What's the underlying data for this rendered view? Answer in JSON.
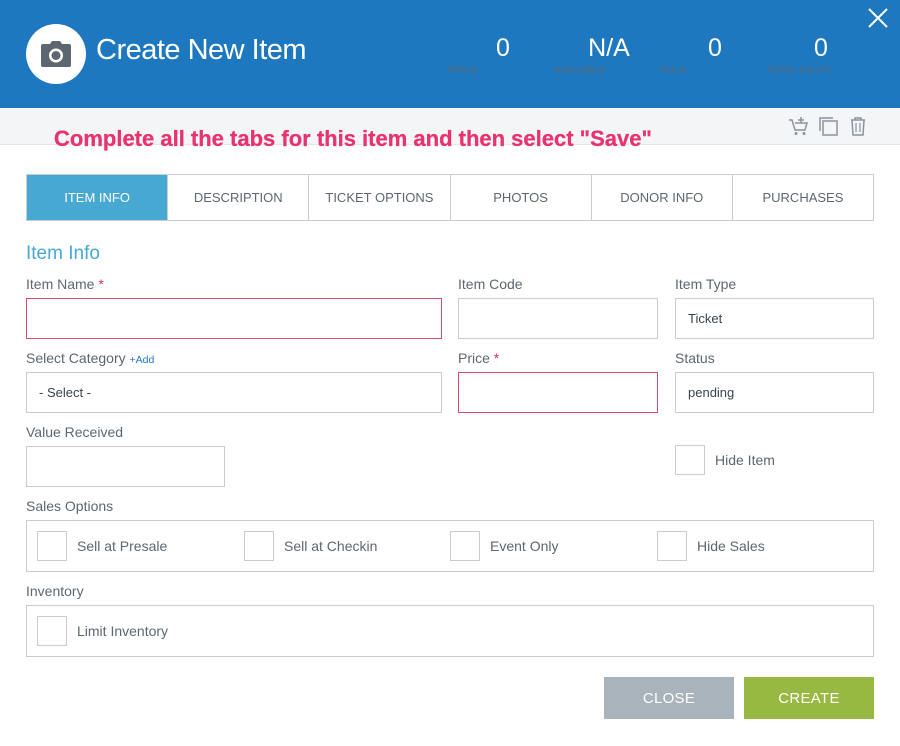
{
  "header": {
    "title": "Create New Item",
    "stats": [
      {
        "value": "0",
        "label": "PRICE"
      },
      {
        "value": "N/A",
        "label": "AVAILABLE"
      },
      {
        "value": "0",
        "label": "SOLD"
      },
      {
        "value": "0",
        "label": "TOTAL SALES"
      }
    ],
    "colors": {
      "bar": "#1e78bf",
      "accent": "#47a9d2"
    }
  },
  "annotation": "Complete all the tabs for this item and then select \"Save\"",
  "toolbar": {
    "icons": [
      "add-to-cart-icon",
      "duplicate-icon",
      "trash-icon"
    ]
  },
  "tabs": [
    {
      "label": "ITEM INFO",
      "active": true
    },
    {
      "label": "DESCRIPTION",
      "active": false
    },
    {
      "label": "TICKET OPTIONS",
      "active": false
    },
    {
      "label": "PHOTOS",
      "active": false
    },
    {
      "label": "DONOR INFO",
      "active": false
    },
    {
      "label": "PURCHASES",
      "active": false
    }
  ],
  "form": {
    "section_title": "Item Info",
    "item_name": {
      "label": "Item Name",
      "required_mark": "*",
      "value": ""
    },
    "item_code": {
      "label": "Item Code",
      "value": ""
    },
    "item_type": {
      "label": "Item Type",
      "value": "Ticket"
    },
    "category": {
      "label": "Select Category",
      "add_link": "+Add",
      "value": "- Select -"
    },
    "price": {
      "label": "Price",
      "required_mark": "*",
      "value": ""
    },
    "status": {
      "label": "Status",
      "value": "pending"
    },
    "value_received": {
      "label": "Value Received",
      "value": ""
    },
    "hide_item": {
      "label": "Hide Item",
      "checked": false
    },
    "sales_options": {
      "label": "Sales Options",
      "options": [
        {
          "label": "Sell at Presale",
          "checked": false
        },
        {
          "label": "Sell at Checkin",
          "checked": false
        },
        {
          "label": "Event Only",
          "checked": false
        },
        {
          "label": "Hide Sales",
          "checked": false
        }
      ]
    },
    "inventory": {
      "label": "Inventory",
      "limit_label": "Limit Inventory",
      "checked": false
    }
  },
  "buttons": {
    "close": "CLOSE",
    "create": "CREATE"
  }
}
